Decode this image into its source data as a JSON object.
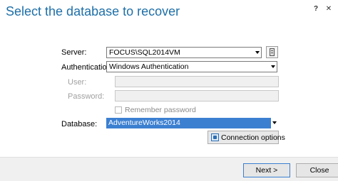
{
  "dialog": {
    "title": "Select the database to recover",
    "help_label": "?",
    "close_glyph": "✕"
  },
  "form": {
    "server_label": "Server:",
    "server_value": "FOCUS\\SQL2014VM",
    "authentication_label": "Authentication:",
    "authentication_value": "Windows Authentication",
    "user_label": "User:",
    "user_value": "",
    "password_label": "Password:",
    "password_value": "",
    "remember_password_label": "Remember password",
    "remember_password_checked": false,
    "database_label": "Database:",
    "database_value": "AdventureWorks2014",
    "connection_options_label": "Connection options"
  },
  "footer": {
    "next_label": "Next >",
    "close_label": "Close"
  },
  "colors": {
    "title": "#1e6fa8",
    "selection": "#3b7fd1"
  },
  "icons": {
    "browse": "server-browse-icon",
    "connection_options": "connection-options-icon"
  }
}
